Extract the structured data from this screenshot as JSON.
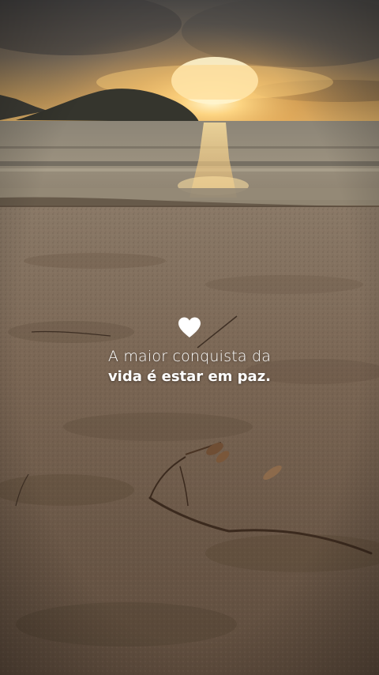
{
  "quote": {
    "icon": "heart-icon",
    "line1": "A maior conquista da",
    "line2": "vida é estar em paz."
  },
  "colors": {
    "text": "#ffffff",
    "sun": "#ffd27a",
    "sand": "#7b6754"
  }
}
